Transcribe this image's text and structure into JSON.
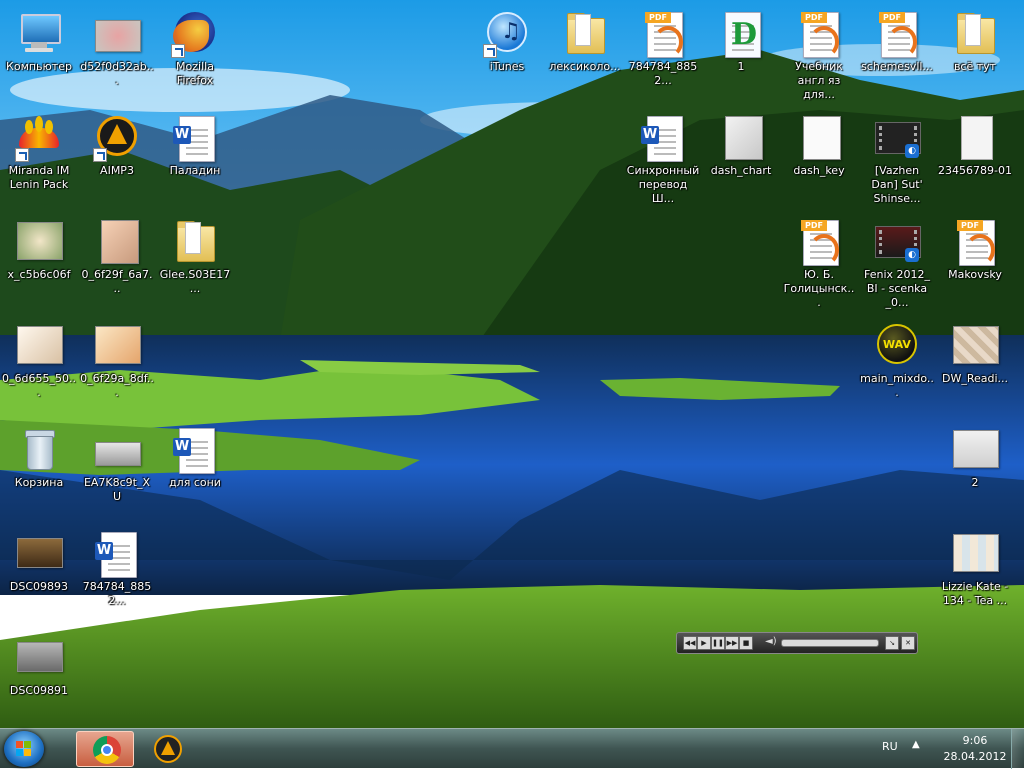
{
  "desktop": {
    "icons": [
      {
        "label": "Компьютер",
        "type": "computer",
        "shortcut": false
      },
      {
        "label": "d52f0d32ab...",
        "type": "photo",
        "shortcut": false
      },
      {
        "label": "Mozilla Firefox",
        "type": "firefox",
        "shortcut": true
      },
      {
        "label": "iTunes",
        "type": "itunes",
        "shortcut": true
      },
      {
        "label": "лексиколо...",
        "type": "folder",
        "shortcut": false
      },
      {
        "label": "784784_8852...",
        "type": "pdf",
        "shortcut": false
      },
      {
        "label": "1",
        "type": "doc",
        "shortcut": false
      },
      {
        "label": "Учебник англ яз для...",
        "type": "pdf",
        "shortcut": false
      },
      {
        "label": "schemesvll...",
        "type": "pdf",
        "shortcut": false
      },
      {
        "label": "всё тут",
        "type": "folder",
        "shortcut": false
      },
      {
        "label": "Miranda IM Lenin Pack",
        "type": "miranda",
        "shortcut": true
      },
      {
        "label": "AIMP3",
        "type": "aimp",
        "shortcut": true
      },
      {
        "label": "Паладин",
        "type": "word",
        "shortcut": false
      },
      {
        "label": "Синхронный перевод Ш...",
        "type": "word",
        "shortcut": false
      },
      {
        "label": "dash_chart",
        "type": "photo",
        "shortcut": false
      },
      {
        "label": "dash_key",
        "type": "doc",
        "shortcut": false
      },
      {
        "label": "[Vazhen Dan] Sut' Shinse...",
        "type": "video",
        "shortcut": false
      },
      {
        "label": "23456789-01",
        "type": "blank",
        "shortcut": false
      },
      {
        "label": "x_c5b6c06f",
        "type": "photo",
        "shortcut": false
      },
      {
        "label": "0_6f29f_6a7...",
        "type": "photo",
        "shortcut": false
      },
      {
        "label": "Glee.S03E17...",
        "type": "folder",
        "shortcut": false
      },
      {
        "label": "Ю. Б. Голицынск...",
        "type": "pdf",
        "shortcut": false
      },
      {
        "label": "Fenix 2012_ BI - scenka _0...",
        "type": "video",
        "shortcut": false
      },
      {
        "label": "Makovsky",
        "type": "pdf",
        "shortcut": false
      },
      {
        "label": "0_6d655_50...",
        "type": "photo",
        "shortcut": false
      },
      {
        "label": "0_6f29a_8df...",
        "type": "photo",
        "shortcut": false
      },
      {
        "label": "main_mixdo...",
        "type": "wav",
        "shortcut": false
      },
      {
        "label": "DW_Readi...",
        "type": "photo",
        "shortcut": false
      },
      {
        "label": "Корзина",
        "type": "recycle",
        "shortcut": false
      },
      {
        "label": "EA7K8c9t_XU",
        "type": "photo",
        "shortcut": false
      },
      {
        "label": "для сони",
        "type": "word",
        "shortcut": false
      },
      {
        "label": "2",
        "type": "photo",
        "shortcut": false
      },
      {
        "label": "DSC09893",
        "type": "photo",
        "shortcut": false
      },
      {
        "label": "784784_8852...",
        "type": "word",
        "shortcut": false
      },
      {
        "label": "Lizzie Kate - 134 - Tea ...",
        "type": "photo",
        "shortcut": false
      },
      {
        "label": "DSC09891",
        "type": "photo",
        "shortcut": false
      }
    ]
  },
  "miniplayer": {
    "controls": [
      "prev-icon",
      "play-icon",
      "pause-icon",
      "next-icon",
      "stop-icon",
      "volume-icon",
      "restore-icon",
      "close-icon"
    ]
  },
  "taskbar": {
    "start_icon": "windows-flag-icon",
    "pinned": [
      {
        "name": "chrome-icon",
        "active": true
      },
      {
        "name": "aimp-icon",
        "active": false
      }
    ],
    "language": "RU",
    "tray_arrow": "▲",
    "time": "9:06",
    "date": "28.04.2012"
  },
  "colors": {
    "taskbar": "#3f5552",
    "sky": "#2fa5e8",
    "water": "#1e4fa8",
    "grass": "#58a624"
  }
}
